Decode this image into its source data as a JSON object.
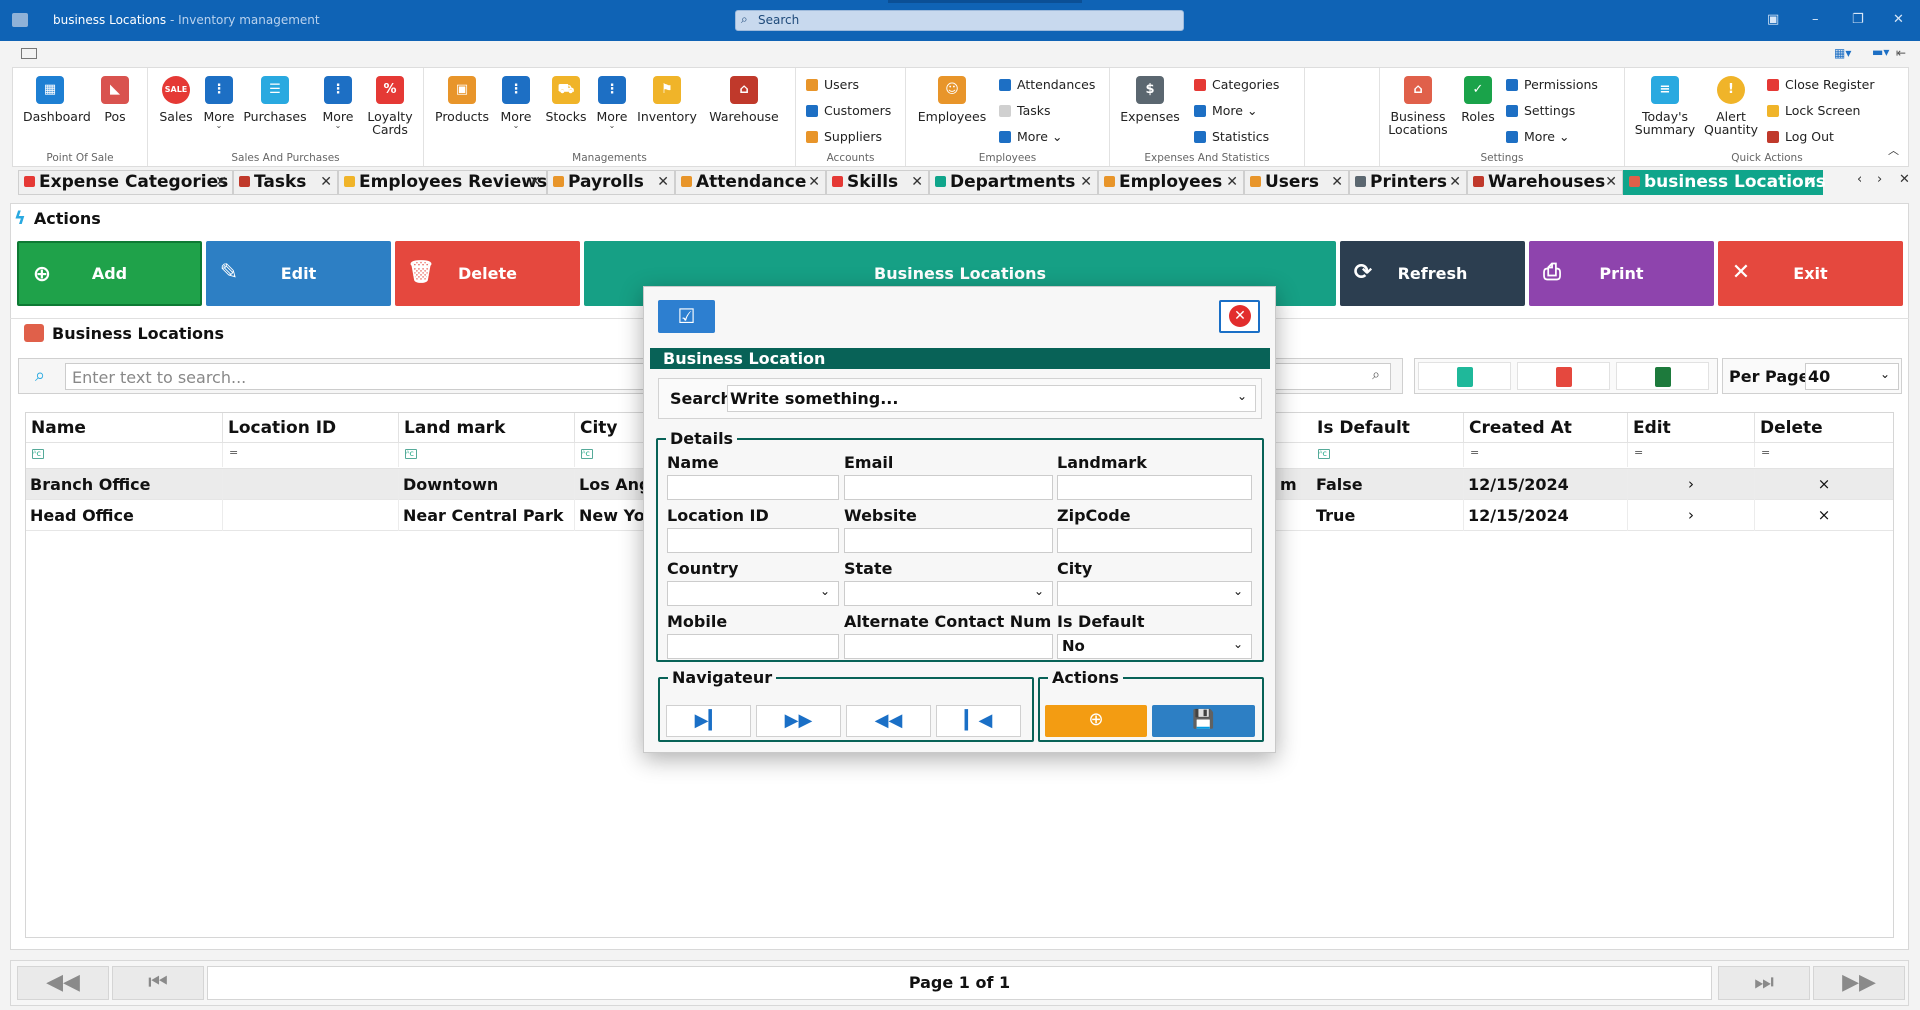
{
  "window": {
    "title": "business Locations",
    "subtitle": " - Inventory management",
    "search_placeholder": "Search",
    "minimize": "–",
    "maximize": "❐",
    "close": "✕"
  },
  "ribbon": {
    "groups": [
      {
        "label": "Point Of Sale",
        "items": [
          {
            "label": "Dashboard",
            "icon": "dashboard-icon",
            "color": "#1d7fd3"
          },
          {
            "label": "Pos",
            "icon": "pos-icon",
            "color": "#d9534f"
          }
        ]
      },
      {
        "label": "Sales And Purchases",
        "items": [
          {
            "label": "Sales",
            "icon": "sale-badge-icon",
            "color": "#e53935"
          },
          {
            "label": "More",
            "icon": "more-icon",
            "color": "#1d6fc4"
          },
          {
            "label": "Purchases",
            "icon": "purchases-icon",
            "color": "#29a9e0"
          },
          {
            "label": "More",
            "icon": "more-icon",
            "color": "#1d6fc4"
          },
          {
            "label": "Loyalty Cards",
            "icon": "loyalty-icon",
            "color": "#e53935"
          }
        ]
      },
      {
        "label": "Managements",
        "items": [
          {
            "label": "Products",
            "icon": "box-icon",
            "color": "#e8952a"
          },
          {
            "label": "More",
            "icon": "more-icon",
            "color": "#1d6fc4"
          },
          {
            "label": "Stocks",
            "icon": "cart-icon",
            "color": "#f0b429"
          },
          {
            "label": "More",
            "icon": "more-icon",
            "color": "#1d6fc4"
          },
          {
            "label": "Inventory",
            "icon": "inventory-icon",
            "color": "#f0b429"
          },
          {
            "label": "Warehouse",
            "icon": "warehouse-icon",
            "color": "#c0392b"
          }
        ]
      },
      {
        "label": "Accounts",
        "items": [
          {
            "label": "Users",
            "icon": "users-icon"
          },
          {
            "label": "Customers",
            "icon": "customers-icon"
          },
          {
            "label": "Suppliers",
            "icon": "suppliers-icon"
          }
        ]
      },
      {
        "label": "Employees",
        "items": [
          {
            "label": "Employees",
            "icon": "employee-icon",
            "color": "#e8952a"
          },
          {
            "label": "Attendances",
            "icon": "calendar-icon"
          },
          {
            "label": "Tasks",
            "icon": "tasks-icon"
          },
          {
            "label": "More",
            "icon": "more-icon"
          }
        ]
      },
      {
        "label": "Expenses And Statistics",
        "items": [
          {
            "label": "Expenses",
            "icon": "money-bag-icon",
            "color": "#5b6770"
          },
          {
            "label": "Categories",
            "icon": "tag-icon"
          },
          {
            "label": "More",
            "icon": "more-icon"
          },
          {
            "label": "Statistics",
            "icon": "chart-icon"
          }
        ]
      },
      {
        "label": "Settings",
        "items": [
          {
            "label": "Business Locations",
            "icon": "store-icon",
            "color": "#e0604a"
          },
          {
            "label": "Roles",
            "icon": "shield-check-icon",
            "color": "#1aa34a"
          },
          {
            "label": "Permissions",
            "icon": "permission-icon"
          },
          {
            "label": "Settings",
            "icon": "gear-icon"
          },
          {
            "label": "More",
            "icon": "more-icon"
          }
        ]
      },
      {
        "label": "Quick Actions",
        "items": [
          {
            "label": "Today's Summary",
            "icon": "summary-icon",
            "color": "#29a9e0"
          },
          {
            "label": "Alert Quantity",
            "icon": "bell-icon",
            "color": "#f0b429"
          },
          {
            "label": "Close Register",
            "icon": "register-icon"
          },
          {
            "label": "Lock Screen",
            "icon": "lock-icon"
          },
          {
            "label": "Log Out",
            "icon": "logout-icon"
          }
        ]
      }
    ]
  },
  "tabs": [
    {
      "label": "Expense Categories",
      "icon": "tag-icon",
      "color": "#e53935"
    },
    {
      "label": "Tasks",
      "icon": "tasks-icon",
      "color": "#c0392b"
    },
    {
      "label": "Employees Reviews",
      "icon": "star-icon",
      "color": "#f0b429"
    },
    {
      "label": "Payrolls",
      "icon": "payroll-icon",
      "color": "#e8952a"
    },
    {
      "label": "Attendance",
      "icon": "attendance-icon",
      "color": "#e8952a"
    },
    {
      "label": "Skills",
      "icon": "skills-icon",
      "color": "#e53935"
    },
    {
      "label": "Departments",
      "icon": "department-icon",
      "color": "#10a58b"
    },
    {
      "label": "Employees",
      "icon": "employee-icon",
      "color": "#e8952a"
    },
    {
      "label": "Users",
      "icon": "users-icon",
      "color": "#e8952a"
    },
    {
      "label": "Printers",
      "icon": "printer-icon",
      "color": "#5b6770"
    },
    {
      "label": "Warehouses",
      "icon": "warehouse-icon",
      "color": "#c0392b"
    },
    {
      "label": "business Locations",
      "icon": "store-icon",
      "color": "#e0604a",
      "active": true
    }
  ],
  "actions": {
    "title": "Actions",
    "buttons": [
      {
        "label": "Add",
        "icon": "plus-circle-icon",
        "color": "#1fa24a"
      },
      {
        "label": "Edit",
        "icon": "edit-icon",
        "color": "#2d7fc4"
      },
      {
        "label": "Delete",
        "icon": "trash-icon",
        "color": "#e5483e"
      },
      {
        "label": "Business Locations",
        "color": "#16a085"
      },
      {
        "label": "Refresh",
        "icon": "refresh-icon",
        "color": "#2c3e50"
      },
      {
        "label": "Print",
        "icon": "printer-icon",
        "color": "#8e44ad"
      },
      {
        "label": "Exit",
        "icon": "close-icon",
        "color": "#e5483e"
      }
    ]
  },
  "list": {
    "title": "Business Locations",
    "search_placeholder": "Enter text to search...",
    "per_page_label": "Per Page",
    "per_page_value": "40",
    "columns": [
      "Name",
      "Location ID",
      "Land mark",
      "City",
      "Is Default",
      "Created At",
      "Edit",
      "Delete"
    ],
    "rows": [
      {
        "name": "Branch Office",
        "location_id": "",
        "landmark": "Downtown",
        "city": "Los Ange",
        "hidden_tail": "m",
        "is_default": "False",
        "created_at": "12/15/2024",
        "edit": "›",
        "delete": "×"
      },
      {
        "name": "Head Office",
        "location_id": "",
        "landmark": "Near Central Park",
        "city": "New Yor",
        "hidden_tail": "",
        "is_default": "True",
        "created_at": "12/15/2024",
        "edit": "›",
        "delete": "×"
      }
    ]
  },
  "pager": {
    "label": "Page 1 of 1"
  },
  "dialog": {
    "title": "Business Location",
    "search_label": "Search",
    "search_value": "Write something...",
    "details_legend": "Details",
    "fields": {
      "name": "Name",
      "email": "Email",
      "landmark": "Landmark",
      "location_id": "Location ID",
      "website": "Website",
      "zipcode": "ZipCode",
      "country": "Country",
      "state": "State",
      "city": "City",
      "mobile": "Mobile",
      "alt_contact": "Alternate Contact Num",
      "is_default": "Is Default"
    },
    "is_default_value": "No",
    "navigator_legend": "Navigateur",
    "actions_legend": "Actions"
  },
  "colors": {
    "titlebar": "#0f63b5",
    "active_tab": "#10a58b",
    "dialog_header": "#086257"
  }
}
